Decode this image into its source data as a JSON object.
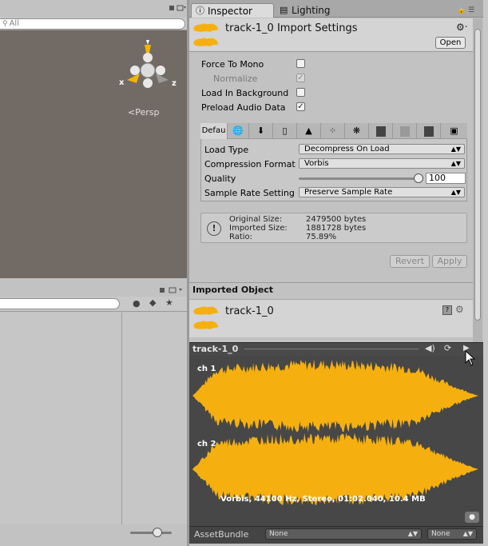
{
  "scene": {
    "search_placeholder": "All",
    "persp_label": "Persp",
    "gizmo_axes": {
      "x": "x",
      "z": "z"
    }
  },
  "inspector": {
    "tabs": [
      {
        "label": "Inspector",
        "icon": "info-icon"
      },
      {
        "label": "Lighting",
        "icon": "lighting-icon"
      }
    ],
    "header_title": "track-1_0 Import Settings",
    "open_label": "Open",
    "options": [
      {
        "label": "Force To Mono",
        "checked": false
      },
      {
        "label": "Normalize",
        "checked": true,
        "disabled": true
      },
      {
        "label": "Load In Background",
        "checked": false
      },
      {
        "label": "Preload Audio Data",
        "checked": true
      }
    ],
    "platform_tab_default": "Defau",
    "platform_icons": [
      "globe-icon",
      "download-icon",
      "phone-icon",
      "android-icon",
      "blackberry-icon",
      "tizen-icon",
      "xbox-icon",
      "windows-store-icon",
      "html5-icon",
      "box-icon"
    ],
    "settings": {
      "load_type": {
        "label": "Load Type",
        "value": "Decompress On Load"
      },
      "compression": {
        "label": "Compression Format",
        "value": "Vorbis"
      },
      "quality": {
        "label": "Quality",
        "value": "100",
        "level": 1.0
      },
      "sample_rate": {
        "label": "Sample Rate Setting",
        "value": "Preserve Sample Rate"
      }
    },
    "info": {
      "original_label": "Original Size:",
      "original_value": "2479500 bytes",
      "imported_label": "Imported Size:",
      "imported_value": "1881728 bytes",
      "ratio_label": "Ratio:",
      "ratio_value": "75.89%"
    },
    "revert_label": "Revert",
    "apply_label": "Apply",
    "imported_object_title": "Imported Object",
    "imported_object_name": "track-1_0"
  },
  "preview": {
    "title": "track-1_0",
    "channels": [
      "ch 1",
      "ch 2"
    ],
    "info_text": "Vorbis, 44100 Hz, Stereo, 01:02.040, 10.4 MB",
    "waveform_color": "#f5b010"
  },
  "assetbundle": {
    "label": "AssetBundle",
    "value": "None",
    "variant": "None"
  }
}
